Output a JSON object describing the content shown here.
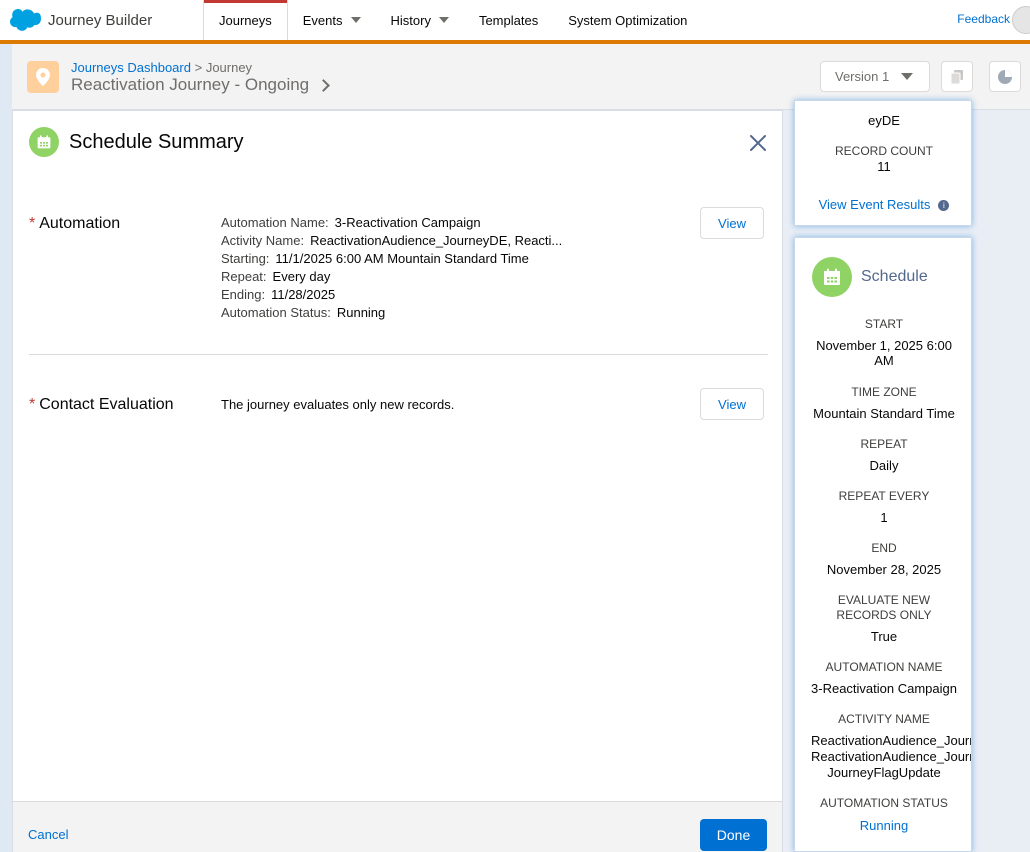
{
  "topnav": {
    "brand": "Journey Builder",
    "tabs": [
      {
        "label": "Journeys",
        "active": true
      },
      {
        "label": "Events",
        "dropdown": true
      },
      {
        "label": "History",
        "dropdown": true
      },
      {
        "label": "Templates"
      },
      {
        "label": "System Optimization"
      }
    ],
    "feedback": "Feedback"
  },
  "subheader": {
    "crumb_link": "Journeys Dashboard",
    "crumb_sep": ">",
    "crumb_current": "Journey",
    "journey_title": "Reactivation Journey - Ongoing",
    "version": "Version 1"
  },
  "modal": {
    "title": "Schedule Summary",
    "automation": {
      "label": "Automation",
      "rows": [
        {
          "key": "Automation Name:",
          "value": "3-Reactivation Campaign"
        },
        {
          "key": "Activity Name:",
          "value": "ReactivationAudience_JourneyDE, Reacti..."
        },
        {
          "key": "Starting:",
          "value": "11/1/2025 6:00 AM Mountain Standard Time"
        },
        {
          "key": "Repeat:",
          "value": "Every day"
        },
        {
          "key": "Ending:",
          "value": "11/28/2025"
        },
        {
          "key": "Automation Status:",
          "value": "Running"
        }
      ],
      "view": "View"
    },
    "evaluation": {
      "label": "Contact Evaluation",
      "text": "The journey evaluates only new records.",
      "view": "View"
    },
    "cancel": "Cancel",
    "done": "Done"
  },
  "event_card": {
    "partial_value": "eyDE",
    "record_count_label": "RECORD COUNT",
    "record_count": "11",
    "view_results": "View Event Results",
    "info_glyph": "i"
  },
  "schedule_card": {
    "title": "Schedule",
    "start_label": "START",
    "start_line1": "November 1, 2025 6:00",
    "start_line2": "AM",
    "tz_label": "TIME ZONE",
    "tz": "Mountain Standard Time",
    "repeat_label": "REPEAT",
    "repeat": "Daily",
    "every_label": "REPEAT EVERY",
    "every": "1",
    "end_label": "END",
    "end": "November 28, 2025",
    "eval_label_1": "EVALUATE NEW",
    "eval_label_2": "RECORDS ONLY",
    "eval": "True",
    "auto_label": "AUTOMATION NAME",
    "auto": "3-Reactivation Campaign",
    "activity_label": "ACTIVITY NAME",
    "activity_1": "ReactivationAudience_JourneyDE",
    "activity_2": "ReactivationAudience_JourneyDE",
    "activity_3": "JourneyFlagUpdate",
    "status_label": "AUTOMATION STATUS",
    "status": "Running"
  },
  "colors": {
    "accent_orange": "#dd7a01",
    "brand_blue": "#0070d2",
    "calendar_green": "#8ed363",
    "required_red": "#c23934"
  }
}
